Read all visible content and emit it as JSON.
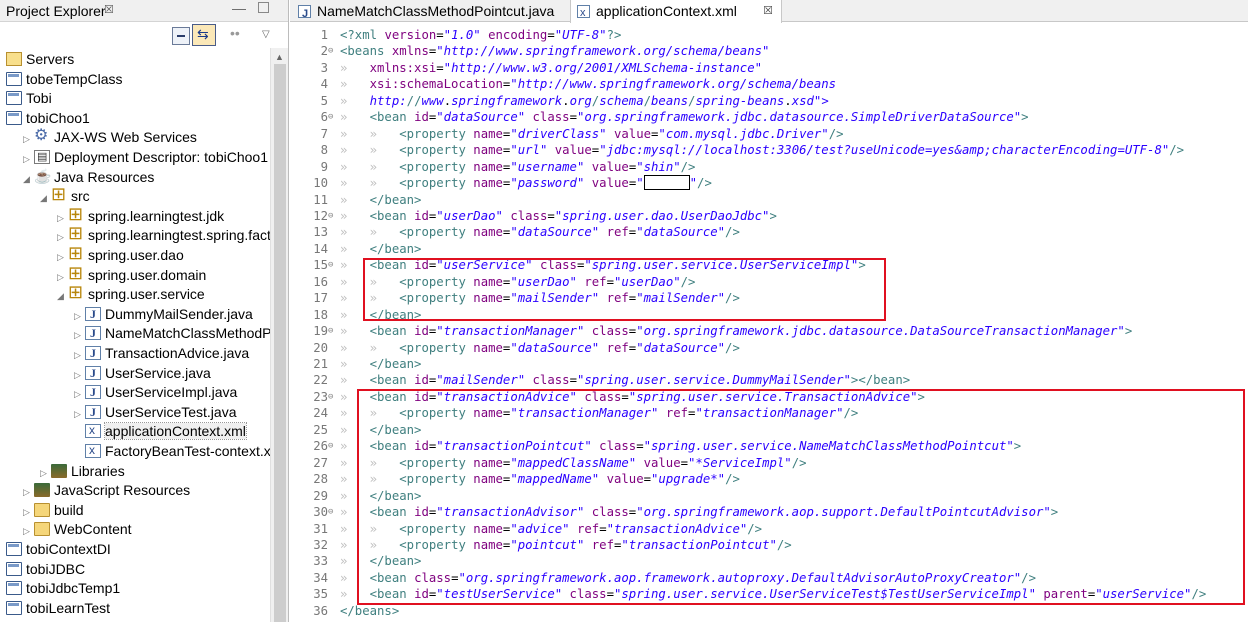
{
  "explorer": {
    "title": "Project Explorer",
    "close_glyph": "☒",
    "tree": [
      {
        "label": "Servers",
        "icon": "folder-open-icon",
        "twisty": ""
      },
      {
        "label": "tobeTempClass",
        "icon": "project-icon",
        "twisty": ""
      },
      {
        "label": "Tobi",
        "icon": "project-icon",
        "twisty": ""
      },
      {
        "label": "tobiChoo1",
        "icon": "web-project-icon",
        "twisty": ""
      },
      {
        "label": "JAX-WS Web Services",
        "icon": "web-services-icon",
        "twisty": "▷"
      },
      {
        "label": "Deployment Descriptor: tobiChoo1",
        "icon": "deployment-descriptor-icon",
        "twisty": "▷"
      },
      {
        "label": "Java Resources",
        "icon": "java-resources-icon",
        "twisty": "◢"
      },
      {
        "label": "src",
        "icon": "source-folder-icon",
        "twisty": "◢"
      },
      {
        "label": "spring.learningtest.jdk",
        "icon": "package-icon",
        "twisty": "▷"
      },
      {
        "label": "spring.learningtest.spring.facto",
        "icon": "package-icon",
        "twisty": "▷"
      },
      {
        "label": "spring.user.dao",
        "icon": "package-icon",
        "twisty": "▷"
      },
      {
        "label": "spring.user.domain",
        "icon": "package-icon",
        "twisty": "▷"
      },
      {
        "label": "spring.user.service",
        "icon": "package-icon",
        "twisty": "◢"
      },
      {
        "label": "DummyMailSender.java",
        "icon": "java-file-icon",
        "twisty": "▷"
      },
      {
        "label": "NameMatchClassMethodP",
        "icon": "java-file-icon",
        "twisty": "▷"
      },
      {
        "label": "TransactionAdvice.java",
        "icon": "java-file-icon",
        "twisty": "▷"
      },
      {
        "label": "UserService.java",
        "icon": "java-file-icon",
        "twisty": "▷"
      },
      {
        "label": "UserServiceImpl.java",
        "icon": "java-file-icon",
        "twisty": "▷"
      },
      {
        "label": "UserServiceTest.java",
        "icon": "java-file-icon",
        "twisty": "▷"
      },
      {
        "label": "applicationContext.xml",
        "icon": "xml-file-icon",
        "twisty": ""
      },
      {
        "label": "FactoryBeanTest-context.xml",
        "icon": "xml-file-icon",
        "twisty": ""
      },
      {
        "label": "Libraries",
        "icon": "libraries-icon",
        "twisty": "▷"
      },
      {
        "label": "JavaScript Resources",
        "icon": "javascript-resources-icon",
        "twisty": "▷"
      },
      {
        "label": "build",
        "icon": "folder-icon",
        "twisty": "▷"
      },
      {
        "label": "WebContent",
        "icon": "folder-icon",
        "twisty": "▷"
      },
      {
        "label": "tobiContextDI",
        "icon": "project-icon",
        "twisty": ""
      },
      {
        "label": "tobiJDBC",
        "icon": "project-icon",
        "twisty": ""
      },
      {
        "label": "tobiJdbcTemp1",
        "icon": "project-icon",
        "twisty": ""
      },
      {
        "label": "tobiLearnTest",
        "icon": "project-icon",
        "twisty": ""
      }
    ]
  },
  "editor": {
    "tabs": [
      {
        "label": "NameMatchClassMethodPointcut.java",
        "icon": "java-file-icon",
        "active": false
      },
      {
        "label": "applicationContext.xml",
        "icon": "xml-file-icon",
        "active": true
      }
    ],
    "tab_close_glyph": "☒",
    "lines": [
      {
        "n": "1",
        "fold": "",
        "code": "<?xml version=\"1.0\" encoding=\"UTF-8\"?>"
      },
      {
        "n": "2",
        "fold": "⊖",
        "code": "<beans xmlns=\"http://www.springframework.org/schema/beans\""
      },
      {
        "n": "3",
        "fold": "",
        "code": "»   xmlns:xsi=\"http://www.w3.org/2001/XMLSchema-instance\""
      },
      {
        "n": "4",
        "fold": "",
        "code": "»   xsi:schemaLocation=\"http://www.springframework.org/schema/beans"
      },
      {
        "n": "5",
        "fold": "",
        "code": "»   http://www.springframework.org/schema/beans/spring-beans.xsd\">"
      },
      {
        "n": "6",
        "fold": "⊖",
        "code": "»   <bean id=\"dataSource\" class=\"org.springframework.jdbc.datasource.SimpleDriverDataSource\">"
      },
      {
        "n": "7",
        "fold": "",
        "code": "»   »   <property name=\"driverClass\" value=\"com.mysql.jdbc.Driver\"/>"
      },
      {
        "n": "8",
        "fold": "",
        "code": "»   »   <property name=\"url\" value=\"jdbc:mysql://localhost:3306/test?useUnicode=yes&amp;characterEncoding=UTF-8\"/>"
      },
      {
        "n": "9",
        "fold": "",
        "code": "»   »   <property name=\"username\" value=\"shin\"/>"
      },
      {
        "n": "10",
        "fold": "",
        "code": "»   »   <property name=\"password\" value=\"[MASK]\"/>"
      },
      {
        "n": "11",
        "fold": "",
        "code": "»   </bean>"
      },
      {
        "n": "12",
        "fold": "⊖",
        "code": "»   <bean id=\"userDao\" class=\"spring.user.dao.UserDaoJdbc\">"
      },
      {
        "n": "13",
        "fold": "",
        "code": "»   »   <property name=\"dataSource\" ref=\"dataSource\"/>"
      },
      {
        "n": "14",
        "fold": "",
        "code": "»   </bean>"
      },
      {
        "n": "15",
        "fold": "⊖",
        "code": "»   <bean id=\"userService\" class=\"spring.user.service.UserServiceImpl\">"
      },
      {
        "n": "16",
        "fold": "",
        "code": "»   »   <property name=\"userDao\" ref=\"userDao\"/>"
      },
      {
        "n": "17",
        "fold": "",
        "code": "»   »   <property name=\"mailSender\" ref=\"mailSender\"/>"
      },
      {
        "n": "18",
        "fold": "",
        "code": "»   </bean>"
      },
      {
        "n": "19",
        "fold": "⊖",
        "code": "»   <bean id=\"transactionManager\" class=\"org.springframework.jdbc.datasource.DataSourceTransactionManager\">"
      },
      {
        "n": "20",
        "fold": "",
        "code": "»   »   <property name=\"dataSource\" ref=\"dataSource\"/>"
      },
      {
        "n": "21",
        "fold": "",
        "code": "»   </bean>"
      },
      {
        "n": "22",
        "fold": "",
        "code": "»   <bean id=\"mailSender\" class=\"spring.user.service.DummyMailSender\"></bean>"
      },
      {
        "n": "23",
        "fold": "⊖",
        "code": "»   <bean id=\"transactionAdvice\" class=\"spring.user.service.TransactionAdvice\">"
      },
      {
        "n": "24",
        "fold": "",
        "code": "»   »   <property name=\"transactionManager\" ref=\"transactionManager\"/>"
      },
      {
        "n": "25",
        "fold": "",
        "code": "»   </bean>"
      },
      {
        "n": "26",
        "fold": "⊖",
        "code": "»   <bean id=\"transactionPointcut\" class=\"spring.user.service.NameMatchClassMethodPointcut\">"
      },
      {
        "n": "27",
        "fold": "",
        "code": "»   »   <property name=\"mappedClassName\" value=\"*ServiceImpl\"/>"
      },
      {
        "n": "28",
        "fold": "",
        "code": "»   »   <property name=\"mappedName\" value=\"upgrade*\"/>"
      },
      {
        "n": "29",
        "fold": "",
        "code": "»   </bean>"
      },
      {
        "n": "30",
        "fold": "⊖",
        "code": "»   <bean id=\"transactionAdvisor\" class=\"org.springframework.aop.support.DefaultPointcutAdvisor\">"
      },
      {
        "n": "31",
        "fold": "",
        "code": "»   »   <property name=\"advice\" ref=\"transactionAdvice\"/>"
      },
      {
        "n": "32",
        "fold": "",
        "code": "»   »   <property name=\"pointcut\" ref=\"transactionPointcut\"/>"
      },
      {
        "n": "33",
        "fold": "",
        "code": "»   </bean>"
      },
      {
        "n": "34",
        "fold": "",
        "code": "»   <bean class=\"org.springframework.aop.framework.autoproxy.DefaultAdvisorAutoProxyCreator\"/>"
      },
      {
        "n": "35",
        "fold": "",
        "code": "»   <bean id=\"testUserService\" class=\"spring.user.service.UserServiceTest$TestUserServiceImpl\" parent=\"userService\"/>"
      },
      {
        "n": "36",
        "fold": "",
        "code": "</beans>"
      }
    ]
  },
  "colors": {
    "highlight_box": "#e01020",
    "xml_tag": "#3f7f7f",
    "xml_attr": "#7f007f",
    "xml_value": "#2a00ff"
  }
}
